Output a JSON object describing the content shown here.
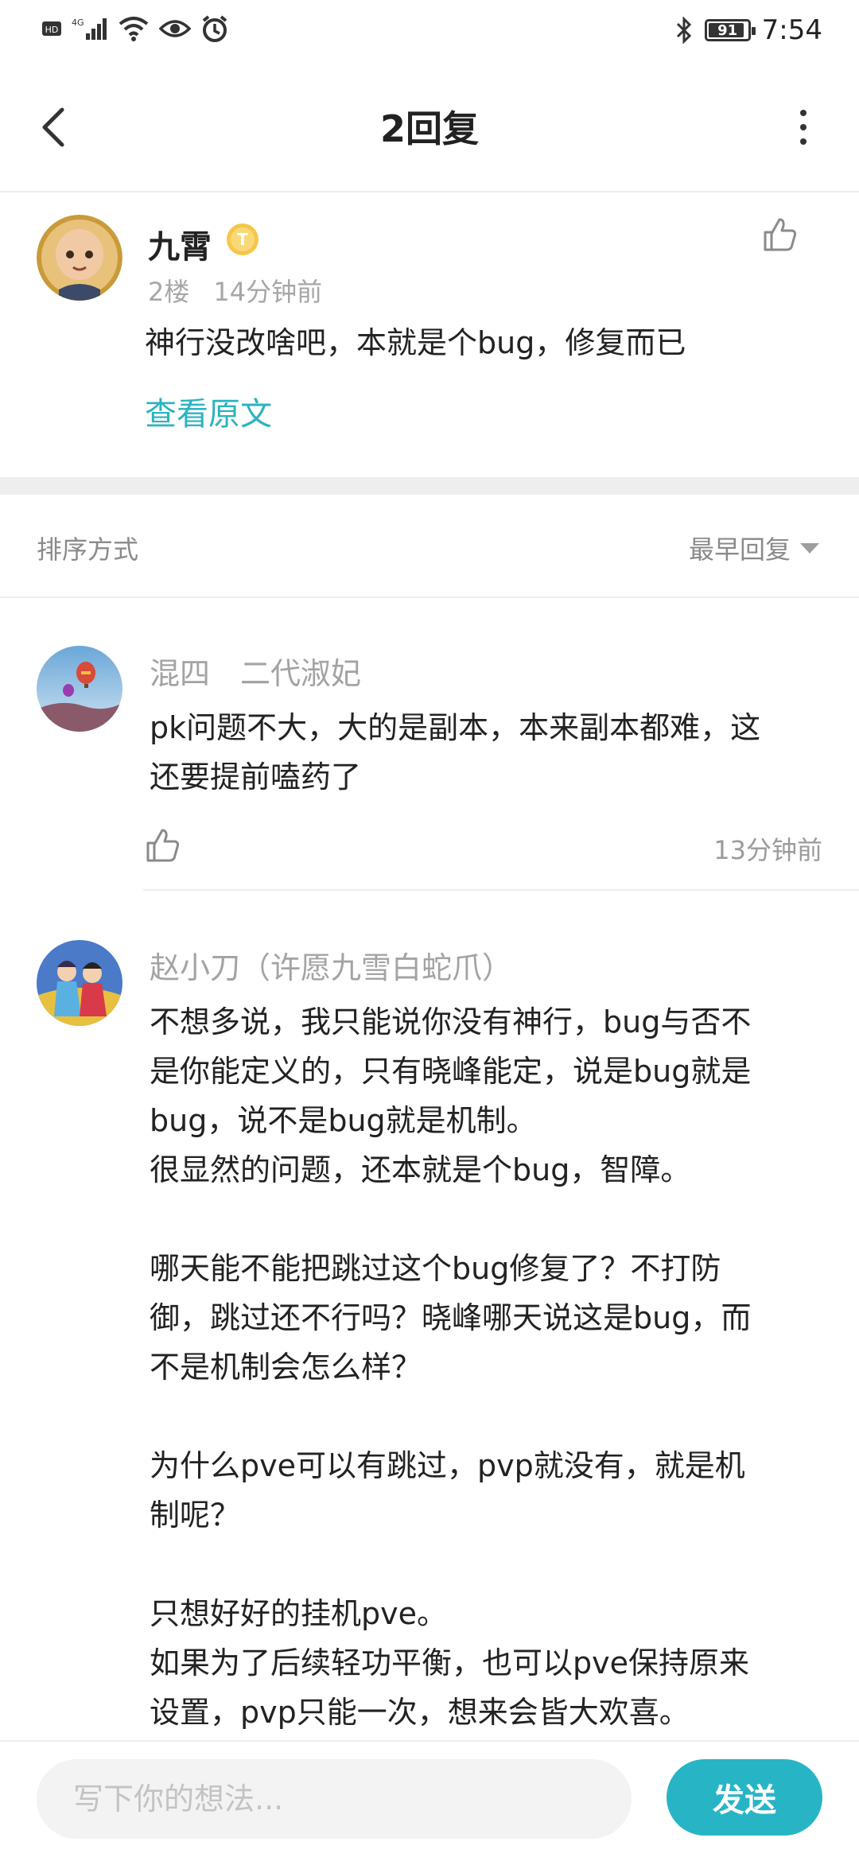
{
  "status_bar": {
    "network": "4G",
    "hd": "HD",
    "battery": "91",
    "time": "7:54"
  },
  "header": {
    "title": "2回复"
  },
  "post": {
    "author": "九霄",
    "badge": "T",
    "floor": "2楼",
    "time": "14分钟前",
    "text": "神行没改啥吧，本就是个bug，修复而已",
    "view_original": "查看原文"
  },
  "sort": {
    "label": "排序方式",
    "value": "最早回复"
  },
  "replies": [
    {
      "author": "混四　二代淑妃",
      "text": "pk问题不大，大的是副本，本来副本都难，这\n还要提前嗑药了",
      "time": "13分钟前"
    },
    {
      "author": "赵小刀（许愿九雪白蛇爪）",
      "text": "不想多说，我只能说你没有神行，bug与否不\n是你能定义的，只有晓峰能定，说是bug就是\nbug，说不是bug就是机制。\n很显然的问题，还本就是个bug，智障。\n\n哪天能不能把跳过这个bug修复了？不打防\n御，跳过还不行吗？晓峰哪天说这是bug，而\n不是机制会怎么样？\n\n为什么pve可以有跳过，pvp就没有，就是机\n制呢？\n\n只想好好的挂机pve。\n如果为了后续轻功平衡，也可以pve保持原来\n设置，pvp只能一次，想来会皆大欢喜。"
    }
  ],
  "composer": {
    "placeholder": "写下你的想法...",
    "send": "发送"
  },
  "colors": {
    "accent": "#27b5c6",
    "link": "#2bb3c0",
    "muted": "#a3a3a3",
    "divider": "#eeeeee"
  },
  "icons": [
    "back-arrow-icon",
    "more-vertical-icon",
    "thumbs-up-icon",
    "caret-down-icon",
    "signal-icon",
    "wifi-icon",
    "eye-icon",
    "alarm-icon",
    "bluetooth-icon",
    "battery-icon"
  ]
}
